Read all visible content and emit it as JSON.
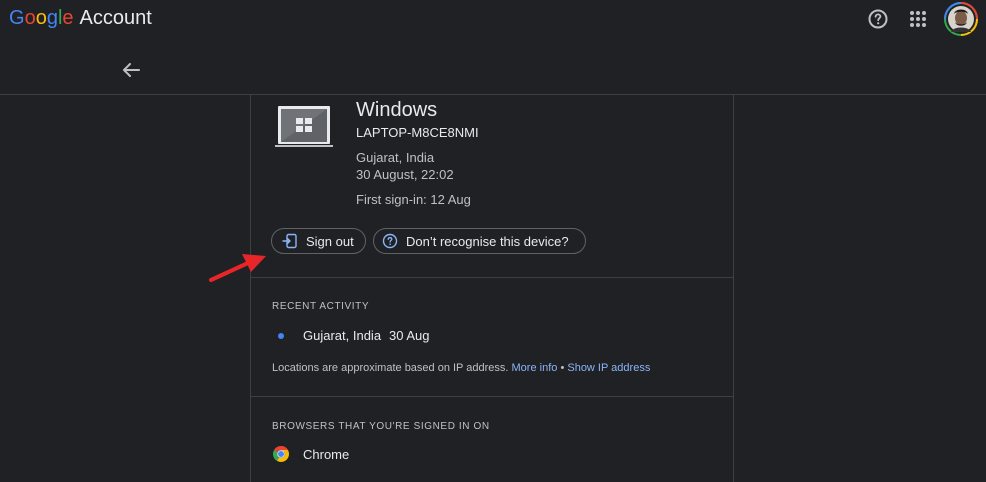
{
  "header": {
    "logo_letters": [
      {
        "ch": "G",
        "color": "#4285f4"
      },
      {
        "ch": "o",
        "color": "#ea4335"
      },
      {
        "ch": "o",
        "color": "#fbbc05"
      },
      {
        "ch": "g",
        "color": "#4285f4"
      },
      {
        "ch": "l",
        "color": "#34a853"
      },
      {
        "ch": "e",
        "color": "#ea4335"
      }
    ],
    "product": "Account",
    "icons": {
      "help": "help-circle-icon",
      "apps": "apps-grid-icon",
      "avatar": "avatar"
    }
  },
  "device": {
    "title": "Windows",
    "name": "LAPTOP-M8CE8NMI",
    "location": "Gujarat, India",
    "last_active": "30 August, 22:02",
    "first_signin": "First sign-in: 12 Aug"
  },
  "actions": {
    "sign_out": "Sign out",
    "dont_recognise": "Don’t recognise this device?"
  },
  "recent_activity": {
    "label": "RECENT ACTIVITY",
    "location": "Gujarat, India",
    "date": "30 Aug",
    "note": "Locations are approximate based on IP address.",
    "more_info": "More info",
    "separator": "•",
    "show_ip": "Show IP address"
  },
  "browsers": {
    "label": "BROWSERS THAT YOU'RE SIGNED IN ON",
    "items": [
      "Chrome"
    ]
  },
  "colors": {
    "background": "#202124",
    "link": "#8ab4f8",
    "accent_dot": "#4285f4",
    "annotation_arrow": "#e8262a"
  }
}
